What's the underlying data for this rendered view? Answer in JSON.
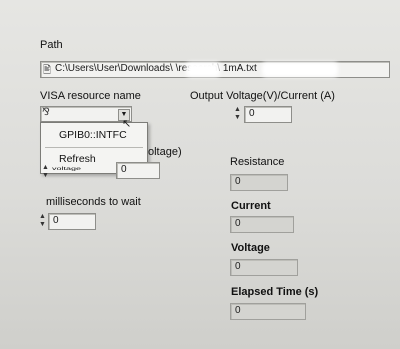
{
  "path": {
    "label": "Path",
    "value": "C:\\Users\\User\\Downloads\\        \\research\\                    1mA.txt"
  },
  "visa": {
    "label": "VISA resource name",
    "value": "",
    "menu": [
      "GPIB0::INTFC",
      "Refresh"
    ]
  },
  "output": {
    "label": "Output Voltage(V)/Current (A)",
    "value": "0"
  },
  "voltage_control": {
    "label_fragment": "oltage)",
    "value": "0",
    "partial_text": "voltage"
  },
  "resistance": {
    "label": "Resistance",
    "value": "0"
  },
  "current": {
    "label": "Current",
    "value": "0"
  },
  "voltage": {
    "label": "Voltage",
    "value": "0"
  },
  "elapsed": {
    "label": "Elapsed Time (s)",
    "value": "0"
  },
  "wait": {
    "label": "milliseconds to wait",
    "value": "0"
  }
}
